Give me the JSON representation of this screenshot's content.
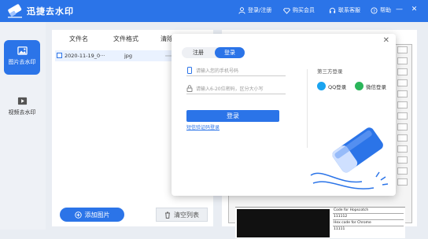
{
  "app": {
    "title": "迅捷去水印"
  },
  "titlebar": {
    "login_label": "登录/注册",
    "vip_label": "购买会员",
    "service_label": "联系客服",
    "help_label": "帮助"
  },
  "sidebar": {
    "items": [
      {
        "label": "图片去水印"
      },
      {
        "label": "视频去水印"
      }
    ]
  },
  "file_table": {
    "columns": [
      "文件名",
      "文件格式",
      "清除"
    ],
    "rows": [
      {
        "name": "2020-11-19_0···",
        "format": "jpg"
      }
    ]
  },
  "buttons": {
    "add": "添加图片",
    "clear": "清空列表"
  },
  "dialog": {
    "tabs": [
      "注册",
      "登录"
    ],
    "active_tab": "登录",
    "phone_placeholder": "请输入您的手机号码",
    "password_placeholder": "请输入6-20位密码，区分大小写",
    "login_button": "登录",
    "sms_link": "短信验证码登录",
    "third_party_title": "第三方登录",
    "qq_label": "QQ登录",
    "wechat_label": "微信登录"
  },
  "preview": {
    "codes": [
      "Code for Hopscotch",
      "111112",
      "Hex code for Chrome",
      "11111"
    ]
  },
  "colors": {
    "accent": "#2b74e8",
    "qq": "#1aa4f0",
    "wechat": "#2bb55a"
  }
}
